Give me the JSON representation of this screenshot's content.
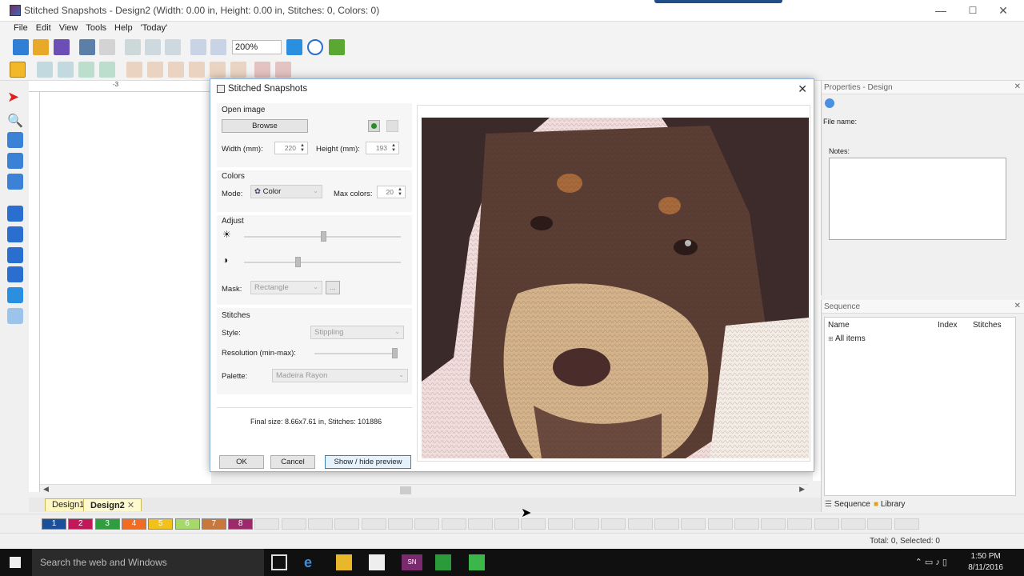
{
  "window": {
    "title": "Stitched Snapshots - Design2 (Width: 0.00 in, Height: 0.00 in, Stitches: 0, Colors: 0)",
    "min": "—",
    "max": "☐",
    "close": "✕"
  },
  "menu": [
    "File",
    "Edit",
    "View",
    "Tools",
    "Help",
    "'Today'"
  ],
  "toolbar": {
    "zoom": "200%"
  },
  "ruler": {
    "top_mark": "-3"
  },
  "dialog": {
    "title": "Stitched Snapshots",
    "open_image": {
      "label": "Open image",
      "browse": "Browse",
      "width_label": "Width (mm):",
      "width": "220",
      "height_label": "Height (mm):",
      "height": "193"
    },
    "colors": {
      "label": "Colors",
      "mode_label": "Mode:",
      "mode": "Color",
      "max_label": "Max colors:",
      "max": "20"
    },
    "adjust": {
      "label": "Adjust",
      "brightness": 0.51,
      "contrast": 0.34,
      "mask_label": "Mask:",
      "mask": "Rectangle",
      "mask_btn": "..."
    },
    "stitches": {
      "label": "Stitches",
      "style_label": "Style:",
      "style": "Stippling",
      "resolution_label": "Resolution (min-max):",
      "resolution": 1.0,
      "palette_label": "Palette:",
      "palette": "Madeira Rayon"
    },
    "final_size": "Final size: 8.66x7.61 in, Stitches: 101886",
    "ok": "OK",
    "cancel": "Cancel",
    "preview": "Show / hide preview"
  },
  "properties": {
    "title": "Properties - Design",
    "file_name_label": "File name:",
    "notes_label": "Notes:"
  },
  "sequence": {
    "title": "Sequence",
    "columns": [
      "Name",
      "Index",
      "Stitches"
    ],
    "rows": [
      "All items"
    ],
    "tabs": [
      "Sequence",
      "Library"
    ]
  },
  "doc_tabs": [
    "Design1",
    "Design2"
  ],
  "colorbar": {
    "swatches": [
      {
        "n": "1",
        "color": "#1a4f9c"
      },
      {
        "n": "2",
        "color": "#c2185b"
      },
      {
        "n": "3",
        "color": "#2e9e3e"
      },
      {
        "n": "4",
        "color": "#f26b21"
      },
      {
        "n": "5",
        "color": "#f2c21b"
      },
      {
        "n": "6",
        "color": "#a5d96a"
      },
      {
        "n": "7",
        "color": "#c8783a"
      },
      {
        "n": "8",
        "color": "#9c2a6a"
      }
    ]
  },
  "status": {
    "text": "Total: 0, Selected: 0"
  },
  "taskbar": {
    "search": "Search the web and Windows",
    "time": "1:50 PM",
    "date": "8/11/2016"
  }
}
